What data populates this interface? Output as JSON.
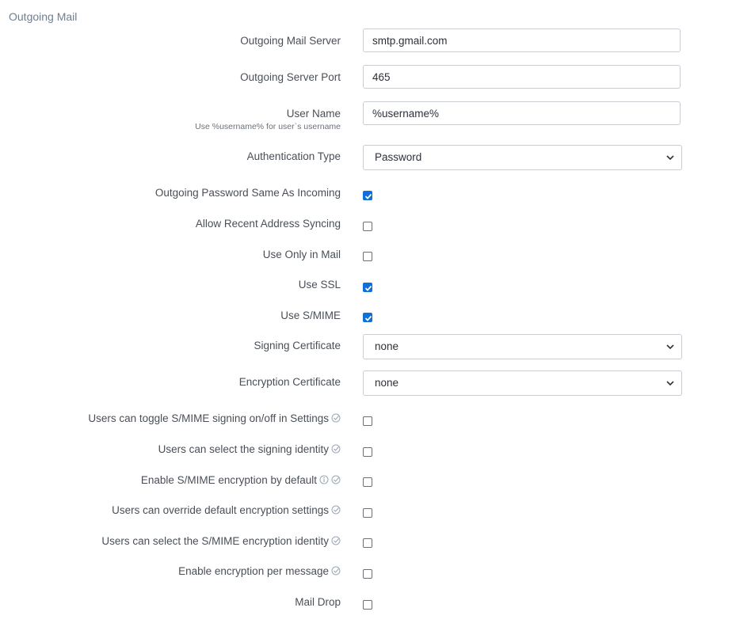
{
  "section": {
    "title": "Outgoing Mail"
  },
  "fields": {
    "server": {
      "label": "Outgoing Mail Server",
      "value": "smtp.gmail.com"
    },
    "port": {
      "label": "Outgoing Server Port",
      "value": "465"
    },
    "username": {
      "label": "User Name",
      "hint": "Use %username% for user`s username",
      "value": "%username%"
    },
    "auth_type": {
      "label": "Authentication Type",
      "value": "Password"
    },
    "signing_cert": {
      "label": "Signing Certificate",
      "value": "none"
    },
    "encryption_cert": {
      "label": "Encryption Certificate",
      "value": "none"
    }
  },
  "checkboxes": {
    "password_same": {
      "label": "Outgoing Password Same As Incoming",
      "checked": true
    },
    "recent_sync": {
      "label": "Allow Recent Address Syncing",
      "checked": false
    },
    "only_mail": {
      "label": "Use Only in Mail",
      "checked": false
    },
    "use_ssl": {
      "label": "Use SSL",
      "checked": true
    },
    "use_smime": {
      "label": "Use S/MIME",
      "checked": true
    },
    "toggle_signing": {
      "label": "Users can toggle S/MIME signing on/off in Settings",
      "checked": false
    },
    "select_signing_identity": {
      "label": "Users can select the signing identity",
      "checked": false
    },
    "enable_encryption_default": {
      "label": "Enable S/MIME encryption by default",
      "checked": false
    },
    "override_encryption": {
      "label": "Users can override default encryption settings",
      "checked": false
    },
    "select_encryption_identity": {
      "label": "Users can select the S/MIME encryption identity",
      "checked": false
    },
    "encryption_per_message": {
      "label": "Enable encryption per message",
      "checked": false
    },
    "mail_drop": {
      "label": "Mail Drop",
      "checked": false
    }
  },
  "icons": {
    "user_setting": "user-setting-check-icon",
    "info": "info-icon",
    "dropdown": "chevron-down-icon"
  },
  "colors": {
    "accent": "#0f6fdb",
    "title": "#6d7f96",
    "border": "#c9cdd2"
  }
}
